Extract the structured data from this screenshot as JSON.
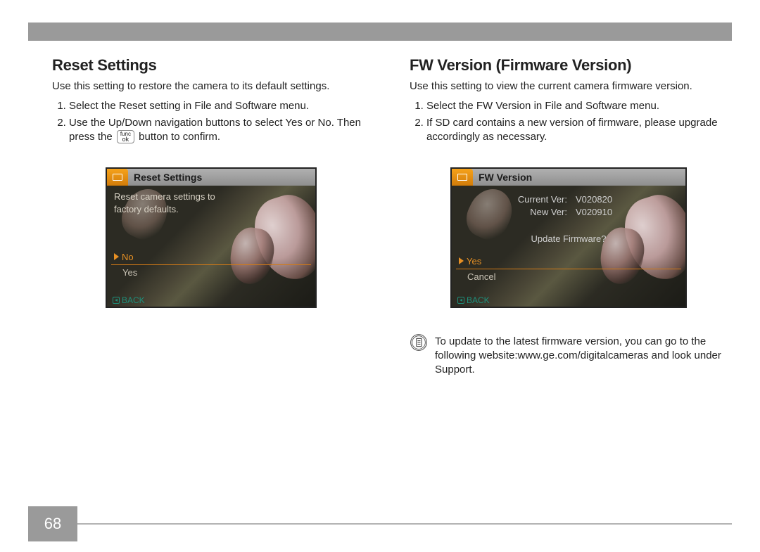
{
  "left": {
    "heading": "Reset Settings",
    "intro": "Use this setting to restore the camera to its default settings.",
    "steps": [
      "Select the Reset setting in File and Software menu.",
      "Use the Up/Down navigation buttons to select Yes or No. Then press the [func/ok] button to confirm."
    ],
    "button_chip": {
      "top": "func",
      "bottom": "ok"
    },
    "screenshot": {
      "title": "Reset Settings",
      "message_l1": "Reset camera settings to",
      "message_l2": "factory defaults.",
      "options": [
        "No",
        "Yes"
      ],
      "selected": "No",
      "back": "BACK"
    }
  },
  "right": {
    "heading": "FW Version (Firmware Version)",
    "intro": "Use this setting to view the current camera firmware version.",
    "steps": [
      "Select the FW Version in File and Software menu.",
      "If SD card contains a new version of firmware, please upgrade accordingly as necessary."
    ],
    "screenshot": {
      "title": "FW Version",
      "current_label": "Current Ver:",
      "current_value": "V020820",
      "new_label": "New Ver:",
      "new_value": "V020910",
      "prompt": "Update Firmware?",
      "options": [
        "Yes",
        "Cancel"
      ],
      "selected": "Yes",
      "back": "BACK"
    },
    "note": "To update to the latest firmware version, you can go to the following website:www.ge.com/digitalcameras and look under Support."
  },
  "page_number": "68"
}
